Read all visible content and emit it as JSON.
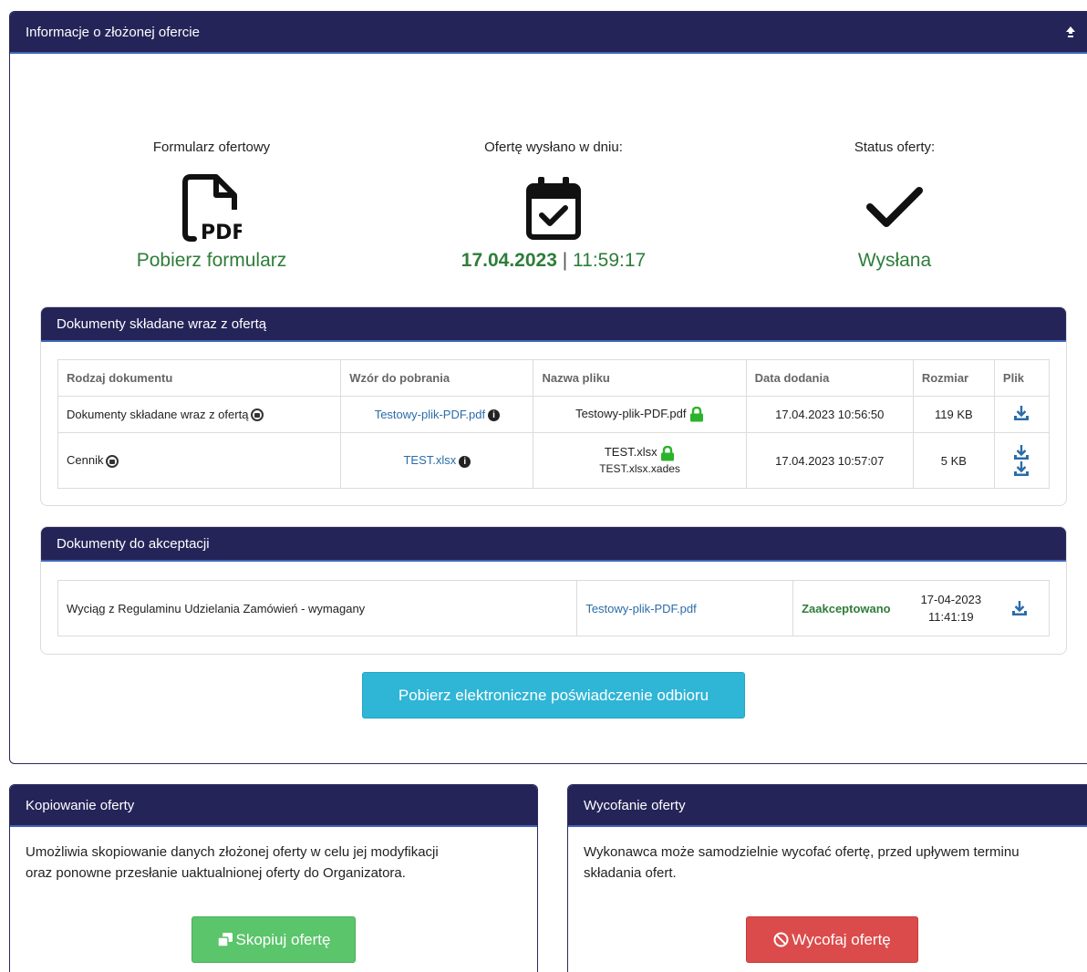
{
  "main": {
    "title": "Informacje o złożonej ofercie",
    "form": {
      "label": "Formularz ofertowy",
      "link": "Pobierz formularz"
    },
    "sent": {
      "label": "Ofertę wysłano w dniu:",
      "date": "17.04.2023",
      "separator": "|",
      "time": "11:59:17"
    },
    "status": {
      "label": "Status oferty:",
      "value": "Wysłana"
    }
  },
  "documents": {
    "title": "Dokumenty składane wraz z ofertą",
    "headers": [
      "Rodzaj dokumentu",
      "Wzór do pobrania",
      "Nazwa pliku",
      "Data dodania",
      "Rozmiar",
      "Plik"
    ],
    "rows": [
      {
        "type": "Dokumenty składane wraz z ofertą",
        "template": "Testowy-plik-PDF.pdf",
        "file": "Testowy-plik-PDF.pdf",
        "file2": "",
        "date": "17.04.2023 10:56:50",
        "size": "119 KB"
      },
      {
        "type": "Cennik",
        "template": "TEST.xlsx",
        "file": "TEST.xlsx",
        "file2": "TEST.xlsx.xades",
        "date": "17.04.2023 10:57:07",
        "size": "5 KB"
      }
    ]
  },
  "acceptance": {
    "title": "Dokumenty do akceptacji",
    "row": {
      "name": "Wyciąg z Regulaminu Udzielania Zamówień - wymagany",
      "file": "Testowy-plik-PDF.pdf",
      "status": "Zaakceptowano",
      "date": "17-04-2023",
      "time": "11:41:19"
    }
  },
  "receipt_button": "Pobierz elektroniczne poświadczenie odbioru",
  "copy": {
    "title": "Kopiowanie oferty",
    "line1": "Umożliwia skopiowanie danych złożonej oferty w celu jej modyfikacji",
    "line2": "oraz ponowne przesłanie uaktualnionej oferty do Organizatora.",
    "button": "Skopiuj ofertę"
  },
  "withdraw": {
    "title": "Wycofanie oferty",
    "line1": "Wykonawca może samodzielnie wycofać ofertę, przed upływem terminu",
    "line2": "składania ofert.",
    "button": "Wycofaj ofertę"
  },
  "colors": {
    "header": "#252459",
    "green": "#2e7d3a",
    "link": "#2b6ca8",
    "info_button": "#2fb5d6",
    "success_button": "#5bc56b",
    "danger_button": "#dc4b4b"
  }
}
